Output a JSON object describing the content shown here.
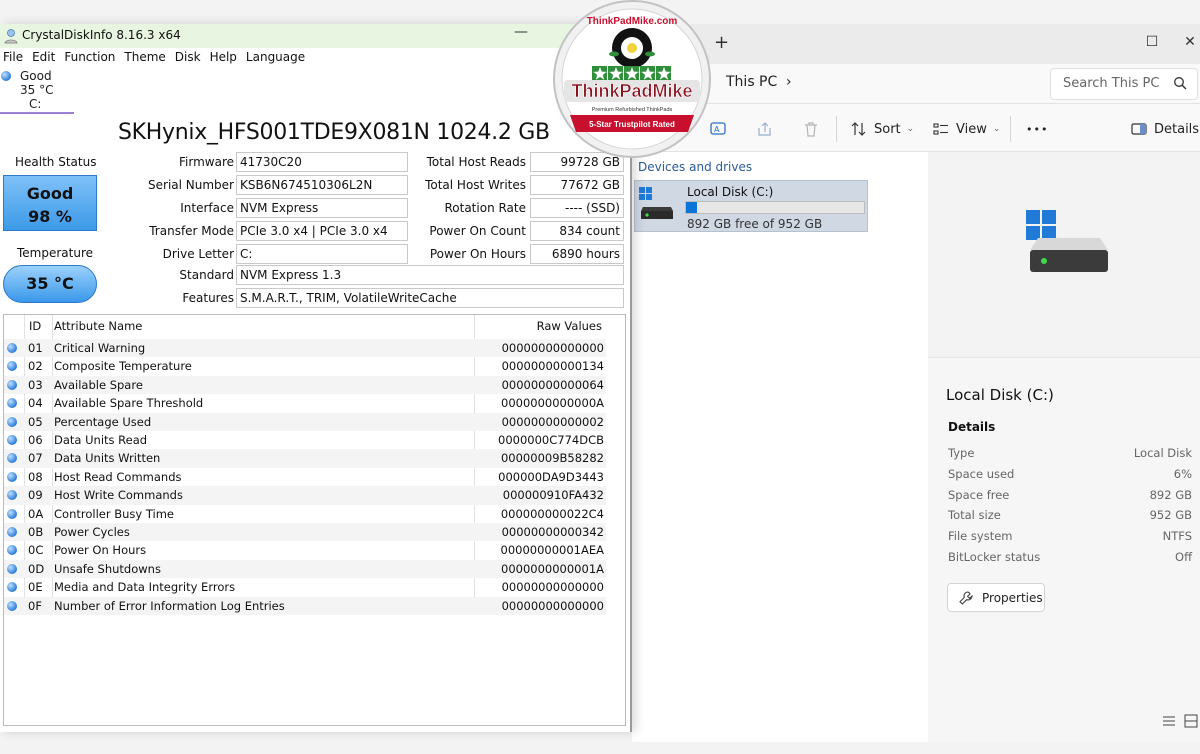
{
  "explorer": {
    "breadcrumb": "This PC",
    "search_placeholder": "Search This PC",
    "toolbar": {
      "sort": "Sort",
      "view": "View",
      "more": "•••",
      "details": "Details"
    },
    "section": "Devices and drives",
    "drive": {
      "label": "Local Disk (C:)",
      "free_text": "892 GB free of 952 GB",
      "used_fraction": 0.06
    },
    "details_pane": {
      "title": "Local Disk (C:)",
      "subtitle": "Details",
      "rows": [
        {
          "k": "Type",
          "v": "Local Disk"
        },
        {
          "k": "Space used",
          "v": "6%"
        },
        {
          "k": "Space free",
          "v": "892 GB"
        },
        {
          "k": "Total size",
          "v": "952 GB"
        },
        {
          "k": "File system",
          "v": "NTFS"
        },
        {
          "k": "BitLocker status",
          "v": "Off"
        }
      ],
      "properties_button": "Properties"
    }
  },
  "cdi": {
    "window_title": "CrystalDiskInfo 8.16.3 x64",
    "menu": [
      "File",
      "Edit",
      "Function",
      "Theme",
      "Disk",
      "Help",
      "Language"
    ],
    "drive_tab": {
      "status": "Good",
      "temp": "35 °C",
      "letter": "C:"
    },
    "model": "SKHynix_HFS001TDE9X081N 1024.2 GB",
    "health_label": "Health Status",
    "health_status": "Good",
    "health_percent": "98 %",
    "temperature_label": "Temperature",
    "temperature": "35 °C",
    "left_fields": [
      {
        "label": "Firmware",
        "value": "41730C20"
      },
      {
        "label": "Serial Number",
        "value": "KSB6N674510306L2N"
      },
      {
        "label": "Interface",
        "value": "NVM Express"
      },
      {
        "label": "Transfer Mode",
        "value": "PCIe 3.0 x4 | PCIe 3.0 x4"
      },
      {
        "label": "Drive Letter",
        "value": "C:"
      }
    ],
    "right_fields": [
      {
        "label": "Total Host Reads",
        "value": "99728 GB"
      },
      {
        "label": "Total Host Writes",
        "value": "77672 GB"
      },
      {
        "label": "Rotation Rate",
        "value": "---- (SSD)"
      },
      {
        "label": "Power On Count",
        "value": "834 count"
      },
      {
        "label": "Power On Hours",
        "value": "6890 hours"
      }
    ],
    "standard_label": "Standard",
    "standard": "NVM Express 1.3",
    "features_label": "Features",
    "features": "S.M.A.R.T., TRIM, VolatileWriteCache",
    "smart_headers": {
      "id": "ID",
      "name": "Attribute Name",
      "raw": "Raw Values"
    },
    "smart_rows": [
      {
        "id": "01",
        "name": "Critical Warning",
        "raw": "00000000000000"
      },
      {
        "id": "02",
        "name": "Composite Temperature",
        "raw": "00000000000134"
      },
      {
        "id": "03",
        "name": "Available Spare",
        "raw": "00000000000064"
      },
      {
        "id": "04",
        "name": "Available Spare Threshold",
        "raw": "0000000000000A"
      },
      {
        "id": "05",
        "name": "Percentage Used",
        "raw": "00000000000002"
      },
      {
        "id": "06",
        "name": "Data Units Read",
        "raw": "0000000C774DCB"
      },
      {
        "id": "07",
        "name": "Data Units Written",
        "raw": "00000009B58282"
      },
      {
        "id": "08",
        "name": "Host Read Commands",
        "raw": "000000DA9D3443"
      },
      {
        "id": "09",
        "name": "Host Write Commands",
        "raw": "000000910FA432"
      },
      {
        "id": "0A",
        "name": "Controller Busy Time",
        "raw": "000000000022C4"
      },
      {
        "id": "0B",
        "name": "Power Cycles",
        "raw": "00000000000342"
      },
      {
        "id": "0C",
        "name": "Power On Hours",
        "raw": "00000000001AEA"
      },
      {
        "id": "0D",
        "name": "Unsafe Shutdowns",
        "raw": "0000000000001A"
      },
      {
        "id": "0E",
        "name": "Media and Data Integrity Errors",
        "raw": "00000000000000"
      },
      {
        "id": "0F",
        "name": "Number of Error Information Log Entries",
        "raw": "00000000000000"
      }
    ]
  },
  "badge": {
    "top": "ThinkPadMike.com",
    "brand": "ThinkPadMike",
    "tagline": "Premium Refurbished ThinkPads",
    "rating": "5-Star Trustpilot Rated",
    "stars": 5
  },
  "colors": {
    "accent": "#0b74d7",
    "health_good": "#3c9ae8",
    "badge_red": "#c8102e"
  }
}
